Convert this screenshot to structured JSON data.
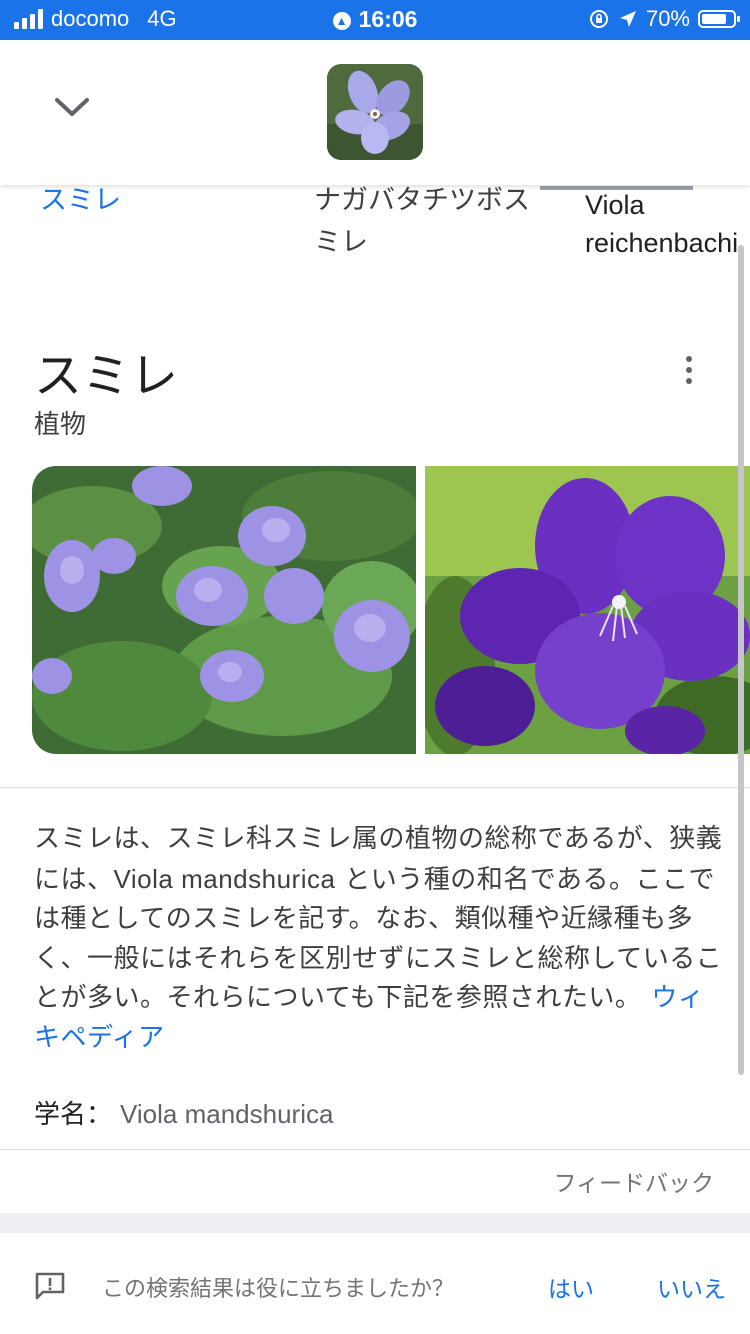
{
  "status_bar": {
    "carrier": "docomo",
    "network": "4G",
    "time": "16:06",
    "battery": "70%",
    "battery_level": 0.7
  },
  "header": {
    "collapse_icon": "chevron-down-icon",
    "thumbnail": "violet-thumbnail"
  },
  "related": [
    {
      "label": "スミレ",
      "selected": true
    },
    {
      "label": "ナガバタチツボスミレ"
    },
    {
      "label": "Viola reichenbachi"
    }
  ],
  "entity": {
    "title": "スミレ",
    "subtitle": "植物",
    "more_icon": "more-vert-icon"
  },
  "description": {
    "part1": "スミレは、スミレ科スミレ属の植物の総称であるが、狭義には、",
    "latin": "Viola mandshurica",
    "part2": " という種の和名である。ここでは種としてのスミレを記す。なお、類似種や近縁種も多く、一般にはそれらを区別せずにスミレと総称していることが多い。それらについても下記を参照されたい。",
    "source": "ウィキペディア"
  },
  "attributes": {
    "sci_label": "学名：",
    "sci_value": "Viola mandshurica"
  },
  "feedback": "フィードバック",
  "bottom_bar": {
    "icon": "feedback-icon",
    "question": "この検索結果は役に立ちましたか？",
    "yes": "はい",
    "no": "いいえ"
  },
  "colors": {
    "accent": "#1a73e8",
    "text": "#202124",
    "muted": "#70757a"
  }
}
